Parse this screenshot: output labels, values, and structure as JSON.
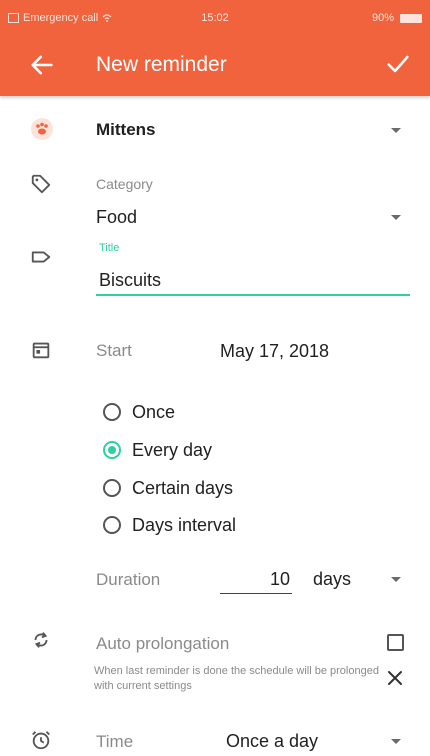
{
  "status_bar": {
    "carrier": "Emergency call",
    "time": "15:02",
    "battery": "90%"
  },
  "appbar": {
    "title": "New reminder",
    "back_icon": "arrow-back-icon",
    "confirm_icon": "check-icon"
  },
  "pet": {
    "name": "Mittens",
    "icon": "paw-icon"
  },
  "category": {
    "label": "Category",
    "value": "Food",
    "icon": "tag-icon"
  },
  "title_field": {
    "label": "Title",
    "value": "Biscuits",
    "icon": "label-icon"
  },
  "start": {
    "label": "Start",
    "value": "May 17, 2018",
    "icon": "calendar-icon"
  },
  "frequency": {
    "options": [
      "Once",
      "Every day",
      "Certain days",
      "Days interval"
    ],
    "selected": "Every day"
  },
  "duration": {
    "label": "Duration",
    "value": "10",
    "unit": "days"
  },
  "auto_prolongation": {
    "label": "Auto prolongation",
    "hint": "When last reminder is done the schedule will be prolonged with current settings",
    "checked": false,
    "icon": "sync-icon"
  },
  "time": {
    "label": "Time",
    "value": "Once a day",
    "icon": "alarm-clock-icon"
  },
  "colors": {
    "accent": "#f0633d",
    "highlight": "#2ecfa3"
  }
}
